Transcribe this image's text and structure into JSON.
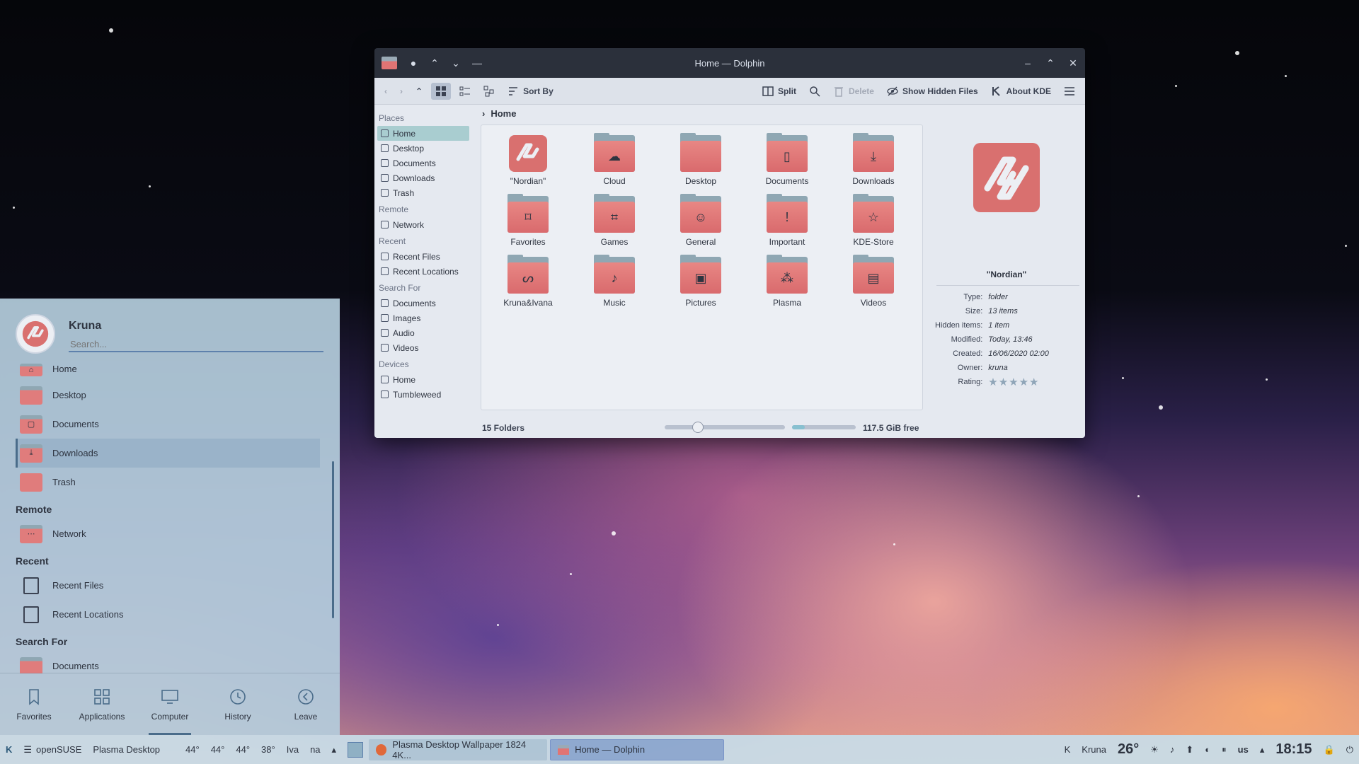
{
  "window": {
    "title": "Home — Dolphin",
    "toolbar": {
      "sort_by": "Sort By",
      "split": "Split",
      "delete": "Delete",
      "show_hidden": "Show Hidden Files",
      "about_kde": "About KDE"
    }
  },
  "places": {
    "groups": [
      {
        "title": "Places",
        "items": [
          "Home",
          "Desktop",
          "Documents",
          "Downloads",
          "Trash"
        ]
      },
      {
        "title": "Remote",
        "items": [
          "Network"
        ]
      },
      {
        "title": "Recent",
        "items": [
          "Recent Files",
          "Recent Locations"
        ]
      },
      {
        "title": "Search For",
        "items": [
          "Documents",
          "Images",
          "Audio",
          "Videos"
        ]
      },
      {
        "title": "Devices",
        "items": [
          "Home",
          "Tumbleweed"
        ]
      }
    ]
  },
  "breadcrumb": {
    "current": "Home"
  },
  "folders": [
    {
      "name": "\"Nordian\"",
      "icon": "nordian-logo-icon"
    },
    {
      "name": "Cloud",
      "icon": "cloud-icon"
    },
    {
      "name": "Desktop",
      "icon": "desktop-icon"
    },
    {
      "name": "Documents",
      "icon": "document-icon"
    },
    {
      "name": "Downloads",
      "icon": "download-icon"
    },
    {
      "name": "Favorites",
      "icon": "bookmark-icon"
    },
    {
      "name": "Games",
      "icon": "gamepad-icon"
    },
    {
      "name": "General",
      "icon": "users-icon"
    },
    {
      "name": "Important",
      "icon": "exclamation-icon"
    },
    {
      "name": "KDE-Store",
      "icon": "star-icon"
    },
    {
      "name": "Kruna&Ivana",
      "icon": "chameleon-icon"
    },
    {
      "name": "Music",
      "icon": "music-note-icon"
    },
    {
      "name": "Pictures",
      "icon": "picture-icon"
    },
    {
      "name": "Plasma",
      "icon": "plasma-icon"
    },
    {
      "name": "Videos",
      "icon": "film-icon"
    }
  ],
  "status": {
    "count": "15 Folders",
    "free": "117.5 GiB free",
    "free_fraction": 0.2,
    "zoom_fraction": 0.25
  },
  "info": {
    "name": "\"Nordian\"",
    "rows": [
      {
        "key": "Type:",
        "value": "folder"
      },
      {
        "key": "Size:",
        "value": "13 items"
      },
      {
        "key": "Hidden items:",
        "value": "1 item"
      },
      {
        "key": "Modified:",
        "value": "Today, 13:46"
      },
      {
        "key": "Created:",
        "value": "16/06/2020 02:00"
      },
      {
        "key": "Owner:",
        "value": "kruna"
      }
    ],
    "rating_label": "Rating:",
    "rating": "★★★★★"
  },
  "launcher": {
    "user": "Kruna",
    "search_placeholder": "Search...",
    "items": {
      "home": "Home",
      "desktop": "Desktop",
      "documents": "Documents",
      "downloads": "Downloads",
      "trash": "Trash",
      "remote": "Remote",
      "network": "Network",
      "recent": "Recent",
      "recent_files": "Recent Files",
      "recent_locations": "Recent Locations",
      "search_for": "Search For",
      "search_documents": "Documents"
    },
    "tabs": [
      "Favorites",
      "Applications",
      "Computer",
      "History",
      "Leave"
    ]
  },
  "panel": {
    "distro": "openSUSE",
    "desktop": "Plasma Desktop",
    "temps": [
      "44°",
      "44°",
      "44°",
      "38°"
    ],
    "users": [
      "Iva",
      "na"
    ],
    "tasks": [
      "Plasma Desktop Wallpaper 1824 4K...",
      "Home — Dolphin"
    ],
    "user": "Kruna",
    "weather": "26°",
    "keyboard": "us",
    "clock": "18:15"
  }
}
